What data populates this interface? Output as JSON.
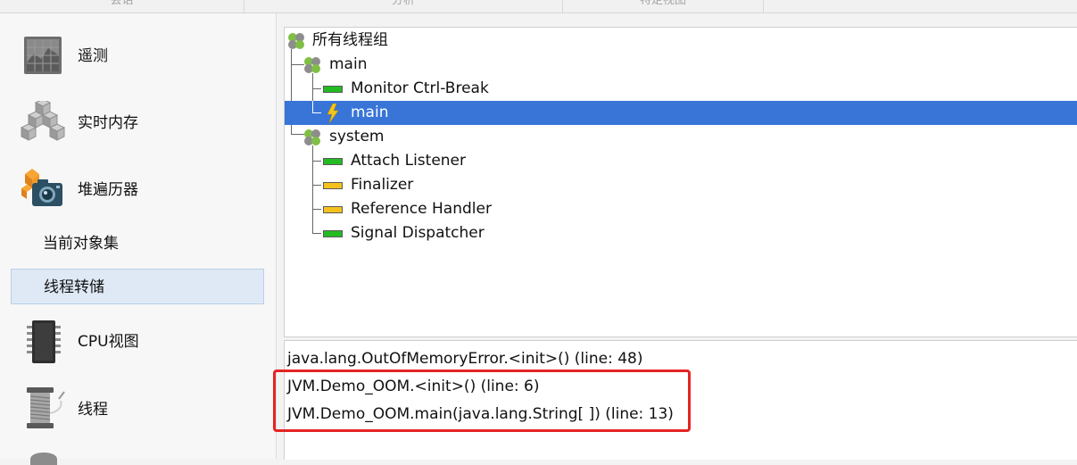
{
  "top_tabs": [
    {
      "label": "会话"
    },
    {
      "label": "分析"
    },
    {
      "label": "特定视图"
    }
  ],
  "sidebar": {
    "items": [
      {
        "label": "遥测",
        "icon": "telemetry-icon"
      },
      {
        "label": "实时内存",
        "icon": "live-memory-icon"
      },
      {
        "label": "堆遍历器",
        "icon": "heap-walker-icon"
      },
      {
        "label": "CPU视图",
        "icon": "cpu-icon"
      },
      {
        "label": "线程",
        "icon": "threads-icon"
      }
    ],
    "sub_items": [
      {
        "label": "当前对象集",
        "selected": false
      },
      {
        "label": "线程转储",
        "selected": true
      }
    ]
  },
  "tree": {
    "root": "所有线程组",
    "group_main": "main",
    "thread_monitor": "Monitor Ctrl-Break",
    "thread_main": "main",
    "group_system": "system",
    "thread_attach": "Attach Listener",
    "thread_finalizer": "Finalizer",
    "thread_reference": "Reference Handler",
    "thread_signal": "Signal Dispatcher",
    "state_colors": {
      "running": "#22bb22",
      "waiting": "#f4c21c",
      "selected_row": "#3875d7"
    }
  },
  "stack": {
    "lines": [
      "java.lang.OutOfMemoryError.<init>() (line: 48)",
      "JVM.Demo_OOM.<init>() (line: 6)",
      "JVM.Demo_OOM.main(java.lang.String[ ]) (line: 13)"
    ],
    "highlight_color": "#e52424"
  }
}
